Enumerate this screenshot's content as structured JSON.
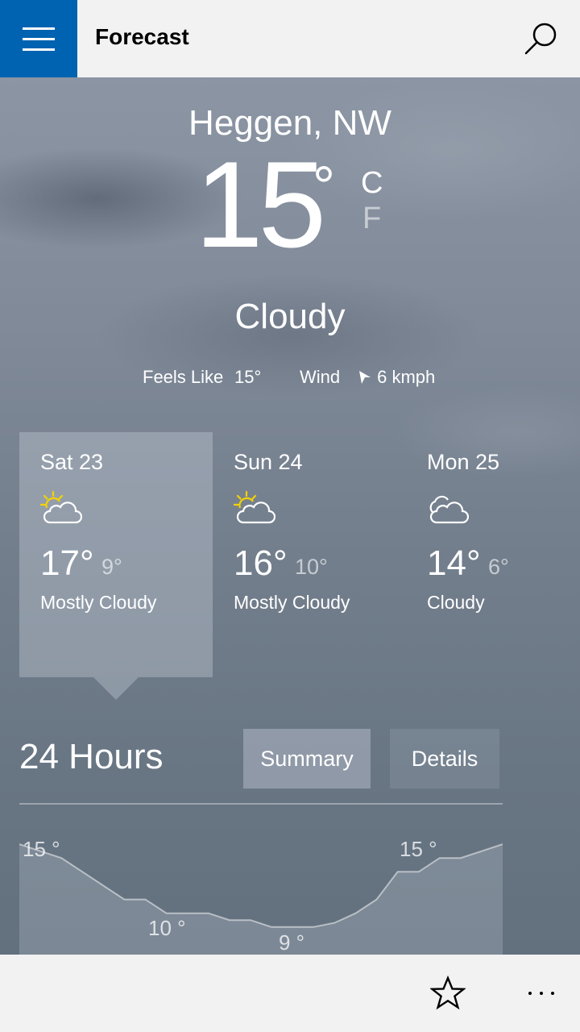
{
  "app": {
    "title": "Forecast"
  },
  "current": {
    "location": "Heggen, NW",
    "temperature": "15",
    "degree_symbol": "°",
    "unit_celsius": "C",
    "unit_fahrenheit": "F",
    "condition": "Cloudy",
    "feels_like_label": "Feels Like",
    "feels_like_value": "15°",
    "wind_label": "Wind",
    "wind_value": "6 kmph"
  },
  "days": [
    {
      "name": "Sat 23",
      "high": "17°",
      "low": "9°",
      "condition": "Mostly Cloudy",
      "icon": "sun-cloud-icon",
      "selected": true
    },
    {
      "name": "Sun 24",
      "high": "16°",
      "low": "10°",
      "condition": "Mostly Cloudy",
      "icon": "sun-cloud-icon",
      "selected": false
    },
    {
      "name": "Mon 25",
      "high": "14°",
      "low": "6°",
      "condition": "Cloudy",
      "icon": "cloud-icon",
      "selected": false
    }
  ],
  "hourly": {
    "title": "24 Hours",
    "summary_label": "Summary",
    "details_label": "Details",
    "temperature_labels": [
      "15 °",
      "10 °",
      "9 °",
      "15 °"
    ]
  },
  "chart_data": {
    "type": "area",
    "x": [
      0,
      1,
      2,
      3,
      4,
      5,
      6,
      7,
      8,
      9,
      10,
      11,
      12,
      13,
      14,
      15,
      16,
      17,
      18,
      19,
      20,
      21,
      22,
      23
    ],
    "series": [
      {
        "values": [
          15,
          14.5,
          14,
          13,
          12,
          11,
          11,
          10,
          10,
          10,
          9.5,
          9.5,
          9,
          9,
          9,
          9.3,
          10,
          11,
          13,
          13,
          14,
          14,
          14.5,
          15
        ]
      }
    ],
    "ylim": [
      7,
      16
    ],
    "annotations": [
      "15 °",
      "10 °",
      "9 °",
      "15 °"
    ],
    "grid": false
  },
  "colors": {
    "accent": "#0063b1",
    "sun": "#f3d200",
    "text_primary": "#ffffff"
  }
}
